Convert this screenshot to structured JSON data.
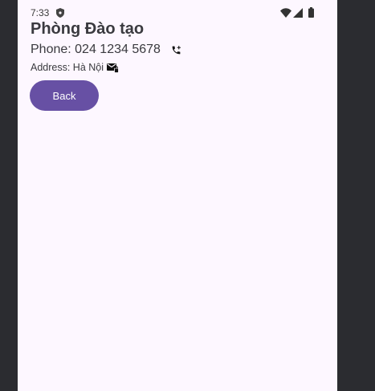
{
  "status_bar": {
    "time": "7:33",
    "icons": [
      "shield-icon",
      "wifi-icon",
      "signal-icon",
      "battery-icon"
    ]
  },
  "contact": {
    "name": "Phòng Đào tạo",
    "phone_label": "Phone: 024 1234 5678",
    "address_label": "Address: Hà Nội",
    "phone_icon": "add-call-icon",
    "address_icon": "mail-lock-icon"
  },
  "actions": {
    "back_label": "Back"
  },
  "colors": {
    "screen_background": "#fdf7ff",
    "frame_background": "#2b2c30",
    "primary": "#6750a4",
    "text": "#3a3a3f"
  }
}
